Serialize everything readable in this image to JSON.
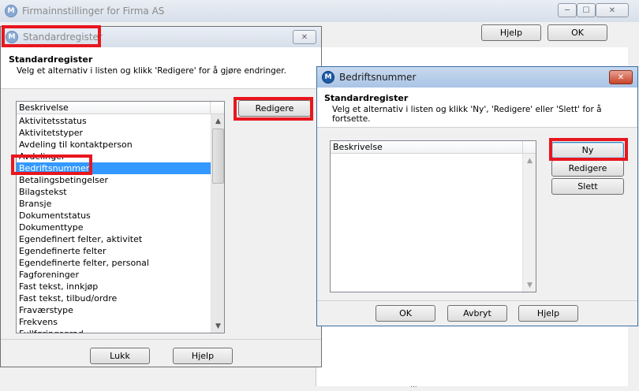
{
  "main_window": {
    "title": "Firmainnstillinger for Firma AS",
    "help_label": "Hjelp",
    "help_accel": "H",
    "ok_label": "OK",
    "ok_accel": "O",
    "tail_text": "..."
  },
  "std_window": {
    "title": "Standardregister",
    "close_glyph": "✕",
    "heading": "Standardregister",
    "instruction": "Velg et alternativ i listen og klikk 'Redigere' for å gjøre endringer.",
    "column_header": "Beskrivelse",
    "edit_label": "Redigere",
    "items": [
      "Aktivitetsstatus",
      "Aktivitetstyper",
      "Avdeling til kontaktperson",
      "Avdelinger",
      "Bedriftsnummer",
      "Betalingsbetingelser",
      "Bilagstekst",
      "Bransje",
      "Dokumentstatus",
      "Dokumenttype",
      "Egendefinert felter, aktivitet",
      "Egendefinerte felter",
      "Egendefinerte felter, personal",
      "Fagforeninger",
      "Fast tekst, innkjøp",
      "Fast tekst, tilbud/ordre",
      "Fraværstype",
      "Frekvens",
      "Fullføringsgrad"
    ],
    "selected_index": 4,
    "close_label": "Lukk",
    "help_label": "Hjelp"
  },
  "bnr_window": {
    "title": "Bedriftsnummer",
    "close_glyph": "✕",
    "heading": "Standardregister",
    "instruction": "Velg et alternativ i listen og klikk 'Ny', 'Redigere' eller 'Slett' for å fortsette.",
    "column_header": "Beskrivelse",
    "new_label": "Ny",
    "edit_label": "Redigere",
    "delete_label": "Slett",
    "ok_label": "OK",
    "cancel_label": "Avbryt",
    "help_label": "Hjelp"
  },
  "icons": {
    "app": "app-logo-icon",
    "scroll_up": "▲",
    "scroll_down": "▼"
  },
  "colors": {
    "highlight": "#e8161e",
    "selection": "#3399ff"
  }
}
